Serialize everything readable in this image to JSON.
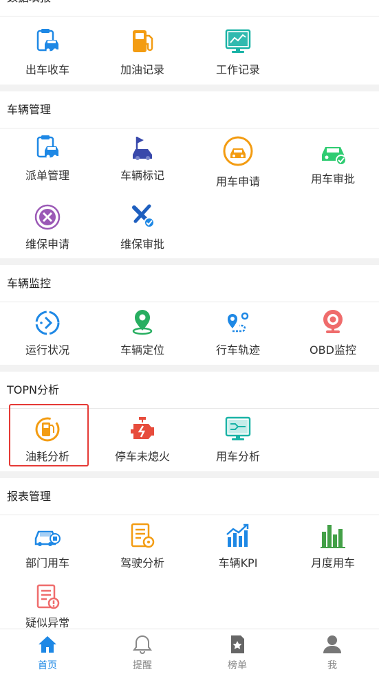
{
  "colors": {
    "blue": "#1e88e5",
    "orange": "#f39c12",
    "teal": "#19b3a6",
    "green": "#2ecc71",
    "purple": "#9b59b6",
    "red": "#e74c3c",
    "highlight": "#e53935",
    "tab_active": "#1e88e5",
    "tab_inactive": "#888888"
  },
  "sections": {
    "data_entry": {
      "title": "数据填报",
      "items": [
        {
          "label": "出车收车",
          "icon": "car-clipboard-icon"
        },
        {
          "label": "加油记录",
          "icon": "fuel-pump-icon"
        },
        {
          "label": "工作记录",
          "icon": "monitor-chart-icon"
        }
      ]
    },
    "vehicle_mgmt": {
      "title": "车辆管理",
      "items": [
        {
          "label": "派单管理",
          "icon": "dispatch-clipboard-icon"
        },
        {
          "label": "车辆标记",
          "icon": "car-flag-icon"
        },
        {
          "label": "用车申请",
          "icon": "car-circle-icon"
        },
        {
          "label": "用车审批",
          "icon": "car-check-icon"
        },
        {
          "label": "维保申请",
          "icon": "tools-circle-icon"
        },
        {
          "label": "维保审批",
          "icon": "tools-check-icon"
        }
      ]
    },
    "vehicle_monitor": {
      "title": "车辆监控",
      "items": [
        {
          "label": "运行状况",
          "icon": "status-arrow-icon"
        },
        {
          "label": "车辆定位",
          "icon": "location-pin-icon"
        },
        {
          "label": "行车轨迹",
          "icon": "route-track-icon"
        },
        {
          "label": "OBD监控",
          "icon": "obd-camera-icon"
        }
      ]
    },
    "topn": {
      "title": "TOPN分析",
      "items": [
        {
          "label": "油耗分析",
          "icon": "fuel-consumption-icon"
        },
        {
          "label": "停车未熄火",
          "icon": "engine-alert-icon"
        },
        {
          "label": "用车分析",
          "icon": "usage-analysis-icon"
        }
      ]
    },
    "reports": {
      "title": "报表管理",
      "items": [
        {
          "label": "部门用车",
          "icon": "department-car-icon"
        },
        {
          "label": "驾驶分析",
          "icon": "driving-analysis-icon"
        },
        {
          "label": "车辆KPI",
          "icon": "kpi-chart-icon"
        },
        {
          "label": "月度用车",
          "icon": "monthly-bars-icon"
        },
        {
          "label": "疑似异常",
          "icon": "suspect-document-icon"
        }
      ]
    }
  },
  "tabs": [
    {
      "label": "首页",
      "icon": "home-icon",
      "active": true
    },
    {
      "label": "提醒",
      "icon": "bell-icon",
      "active": false
    },
    {
      "label": "榜单",
      "icon": "ranking-icon",
      "active": false
    },
    {
      "label": "我",
      "icon": "user-icon",
      "active": false
    }
  ]
}
